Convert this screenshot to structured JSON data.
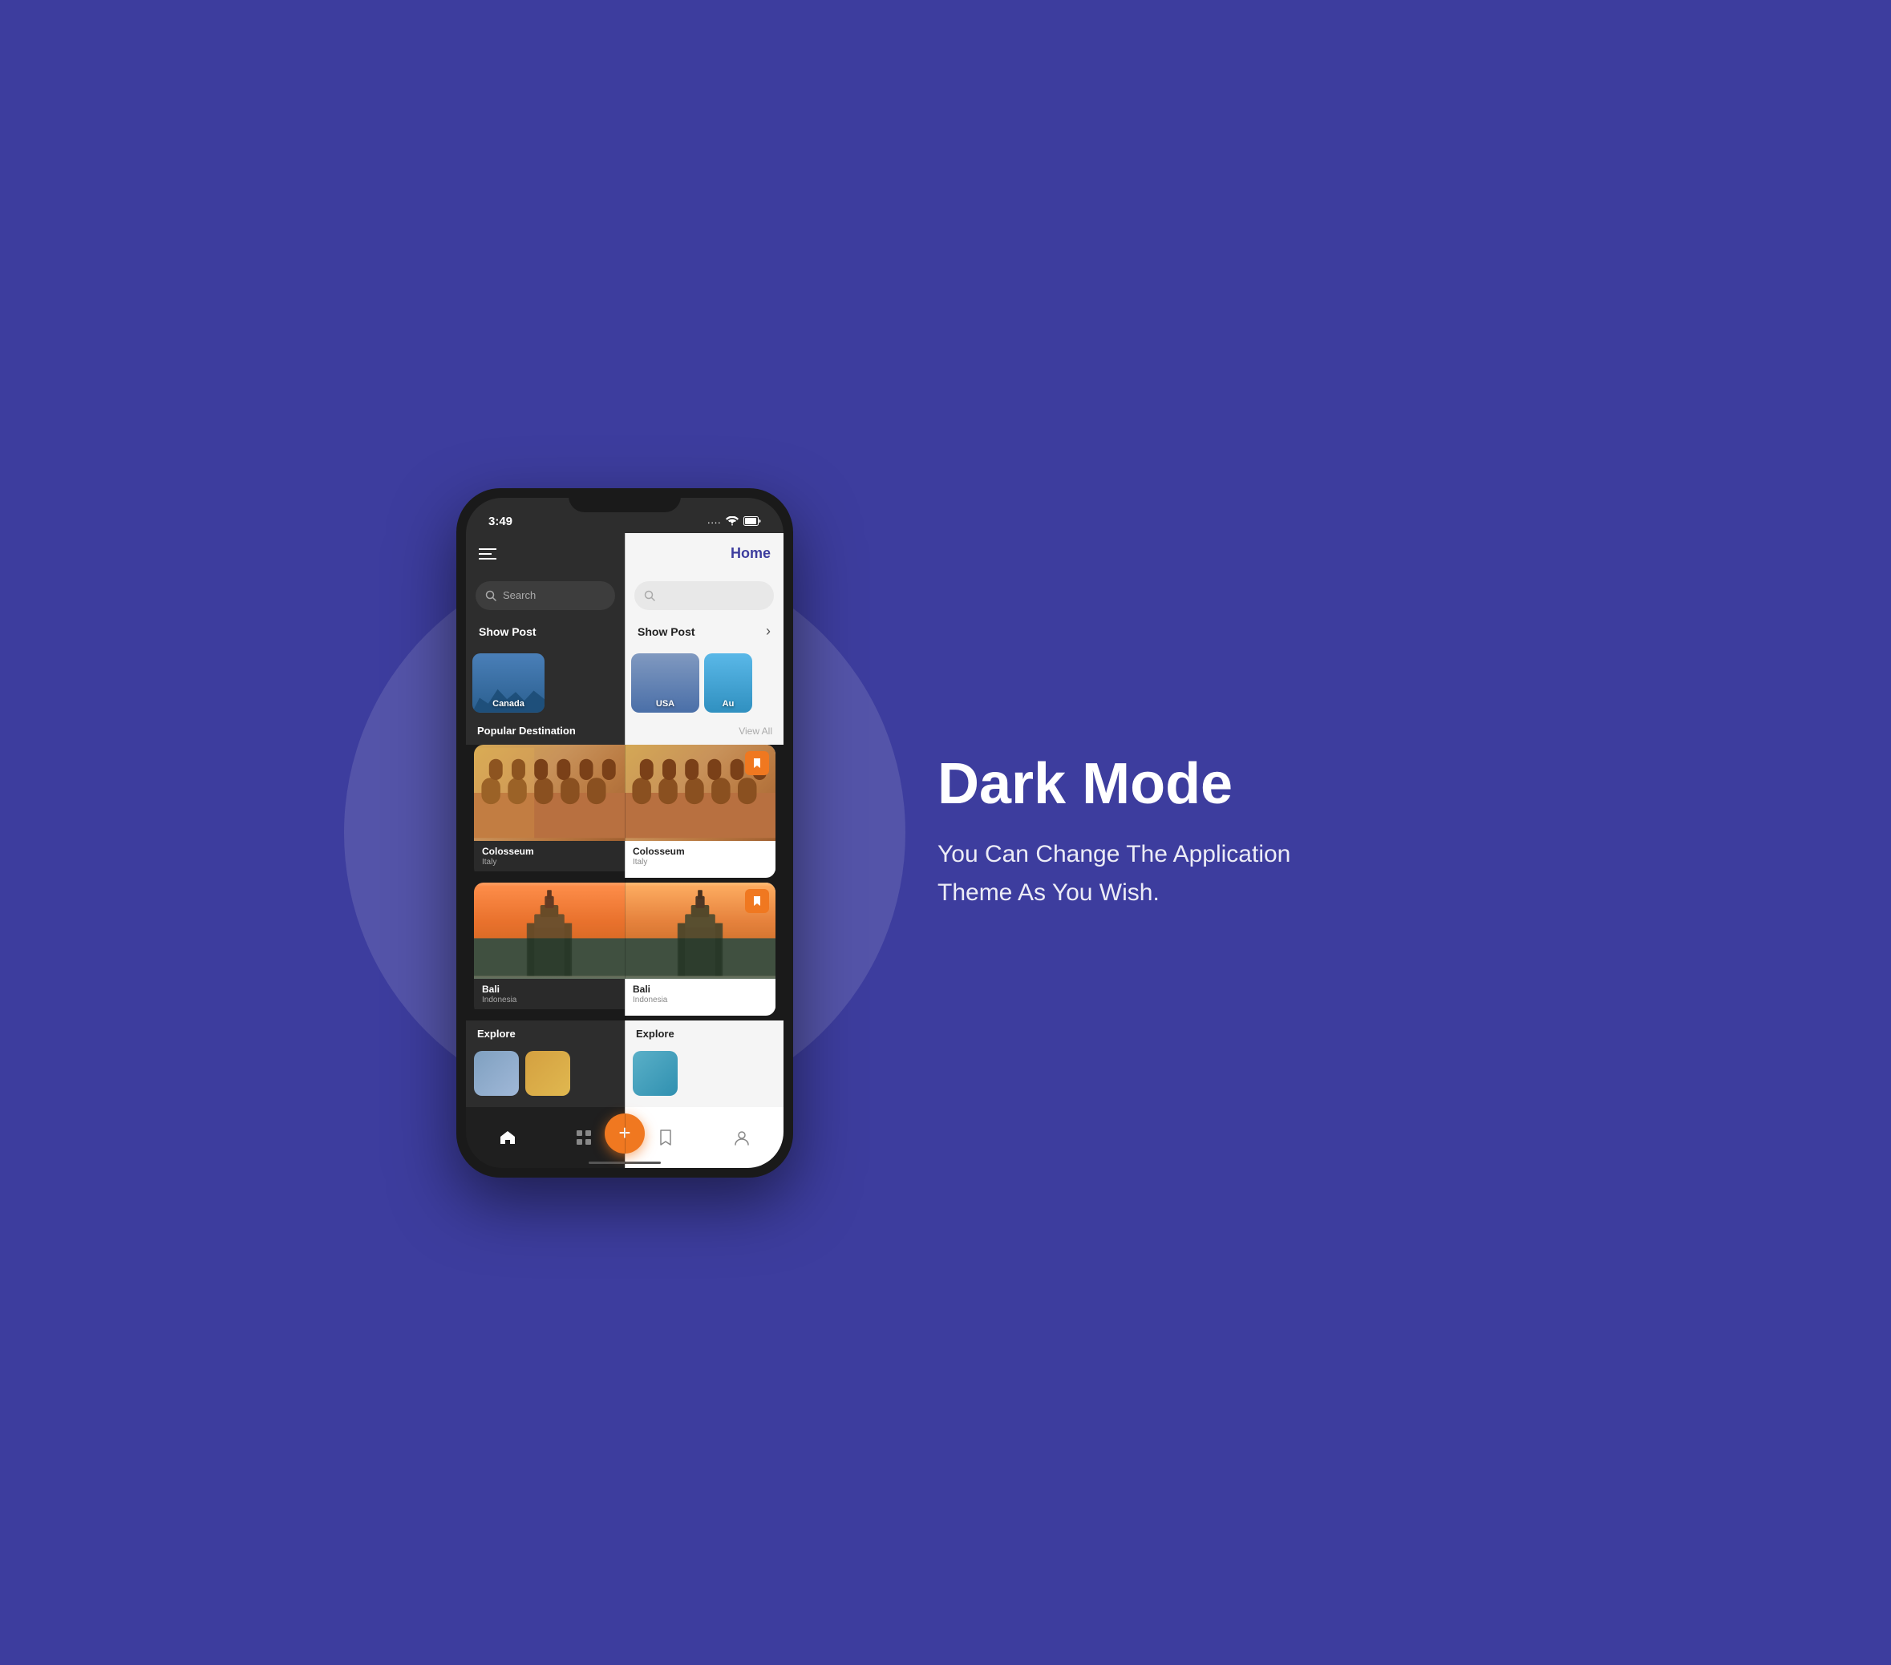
{
  "background_color": "#3d3d9e",
  "page": {
    "phone": {
      "status_bar": {
        "time": "3:49",
        "wifi_icon": "wifi",
        "battery_icon": "battery"
      },
      "header": {
        "menu_icon": "hamburger",
        "title": "Home"
      },
      "search": {
        "placeholder": "Search",
        "icon": "search"
      },
      "show_post": {
        "label": "Show Post",
        "arrow": "›"
      },
      "categories": [
        {
          "name": "Canada",
          "color_start": "#5b8fb9",
          "color_end": "#2d6a8f"
        },
        {
          "name": "USA",
          "color_start": "#6b8fbc",
          "color_end": "#4a7fb8"
        },
        {
          "name": "Au",
          "color_start": "#4a90d9",
          "color_end": "#357abd"
        }
      ],
      "popular_destination": {
        "title": "Popular Destination",
        "view_all": "View All",
        "destinations": [
          {
            "name": "Colosseum",
            "country": "Italy",
            "bookmark": true
          },
          {
            "name": "Bali",
            "country": "Indonesia",
            "bookmark": true
          }
        ]
      },
      "explore": {
        "title": "Explore"
      },
      "bottom_nav": {
        "items": [
          {
            "icon": "home",
            "label": "home",
            "active": true
          },
          {
            "icon": "grid",
            "label": "grid",
            "active": false
          },
          {
            "icon": "fab",
            "label": "add",
            "active": false
          },
          {
            "icon": "bookmark",
            "label": "bookmark",
            "active": false
          },
          {
            "icon": "profile",
            "label": "profile",
            "active": false
          }
        ],
        "fab_label": "+"
      }
    },
    "right_panel": {
      "title": "Dark Mode",
      "description_line1": "You Can Change The Application",
      "description_line2": "Theme As You Wish."
    }
  }
}
